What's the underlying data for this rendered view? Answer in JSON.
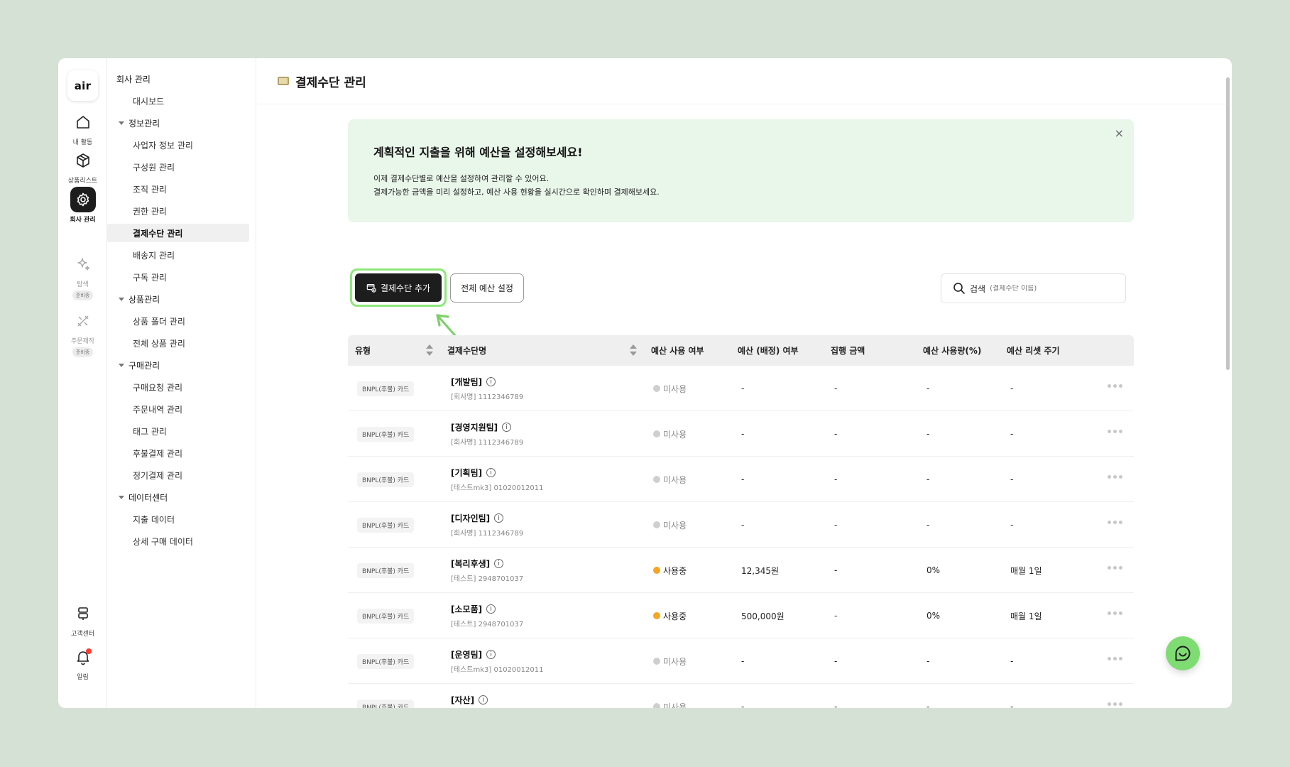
{
  "app": {
    "logo_text": "air"
  },
  "rail": {
    "items": [
      {
        "label": "내 활동",
        "icon": "home-icon"
      },
      {
        "label": "상품리스트",
        "icon": "box-icon"
      },
      {
        "label": "회사 관리",
        "icon": "gear-icon",
        "active": true
      },
      {
        "label": "탐색",
        "icon": "sparkle-icon",
        "badge": "준비중"
      },
      {
        "label": "주문제작",
        "icon": "tools-icon",
        "badge": "준비중"
      },
      {
        "label": "고객센터",
        "icon": "signpost-icon"
      },
      {
        "label": "알림",
        "icon": "bell-icon"
      }
    ]
  },
  "menu": {
    "root": "회사 관리",
    "dashboard": "대시보드",
    "groups": [
      {
        "title": "정보관리",
        "items": [
          "사업자 정보 관리",
          "구성원 관리",
          "조직 관리",
          "권한 관리",
          "결제수단 관리",
          "배송지 관리",
          "구독 관리"
        ]
      },
      {
        "title": "상품관리",
        "items": [
          "상품 폴더 관리",
          "전체 상품 관리"
        ]
      },
      {
        "title": "구매관리",
        "items": [
          "구매요청 관리",
          "주문내역 관리",
          "태그 관리",
          "후불결제 관리",
          "정기결제 관리"
        ]
      },
      {
        "title": "데이터센터",
        "items": [
          "지출 데이터",
          "상세 구매 데이터"
        ]
      }
    ],
    "active_item": "결제수단 관리"
  },
  "header": {
    "title": "결제수단 관리",
    "icon": "card-icon"
  },
  "banner": {
    "title": "계획적인 지출을 위해 예산을 설정해보세요!",
    "line1": "이제 결제수단별로 예산을 설정하여 관리할 수 있어요.",
    "line2": "결제가능한 금액을 미리 설정하고, 예산 사용 현황을 실시간으로 확인하며 결제해보세요.",
    "close": "×"
  },
  "toolbar": {
    "add_label": "결제수단 추가",
    "budget_label": "전체 예산 설정",
    "search_label": "검색",
    "search_placeholder": "(결제수단 이름)"
  },
  "table": {
    "columns": [
      "유형",
      "결제수단명",
      "예산 사용 여부",
      "예산 (배정) 여부",
      "집행 금액",
      "예산 사용량(%)",
      "예산 리셋 주기"
    ],
    "rows": [
      {
        "type": "BNPL(후불) 카드",
        "name": "[개발팀]",
        "sub": "[회사명] 1112346789",
        "status": "미사용",
        "active": false,
        "budget": "-",
        "spent": "-",
        "usage": "-",
        "reset": "-"
      },
      {
        "type": "BNPL(후불) 카드",
        "name": "[경영지원팀]",
        "sub": "[회사명] 1112346789",
        "status": "미사용",
        "active": false,
        "budget": "-",
        "spent": "-",
        "usage": "-",
        "reset": "-"
      },
      {
        "type": "BNPL(후불) 카드",
        "name": "[기획팀]",
        "sub": "[테스트mk3] 01020012011",
        "status": "미사용",
        "active": false,
        "budget": "-",
        "spent": "-",
        "usage": "-",
        "reset": "-"
      },
      {
        "type": "BNPL(후불) 카드",
        "name": "[디자인팀]",
        "sub": "[회사명] 1112346789",
        "status": "미사용",
        "active": false,
        "budget": "-",
        "spent": "-",
        "usage": "-",
        "reset": "-"
      },
      {
        "type": "BNPL(후불) 카드",
        "name": "[복리후생]",
        "sub": "[테스트] 2948701037",
        "status": "사용중",
        "active": true,
        "budget": "12,345원",
        "spent": "-",
        "usage": "0%",
        "reset": "매월 1일"
      },
      {
        "type": "BNPL(후불) 카드",
        "name": "[소모품]",
        "sub": "[테스트] 2948701037",
        "status": "사용중",
        "active": true,
        "budget": "500,000원",
        "spent": "-",
        "usage": "0%",
        "reset": "매월 1일"
      },
      {
        "type": "BNPL(후불) 카드",
        "name": "[운영팀]",
        "sub": "[테스트mk3] 01020012011",
        "status": "미사용",
        "active": false,
        "budget": "-",
        "spent": "-",
        "usage": "-",
        "reset": "-"
      },
      {
        "type": "BNPL(후불) 카드",
        "name": "[자산]",
        "sub": "",
        "status": "미사용",
        "active": false,
        "budget": "-",
        "spent": "-",
        "usage": "-",
        "reset": "-"
      }
    ]
  },
  "colors": {
    "background": "#d6e1d6",
    "banner": "#e9f6ea",
    "highlight": "#8ee87c",
    "status_active": "#f5a623",
    "status_inactive": "#cfcfcf",
    "chat": "#7fdc72"
  }
}
